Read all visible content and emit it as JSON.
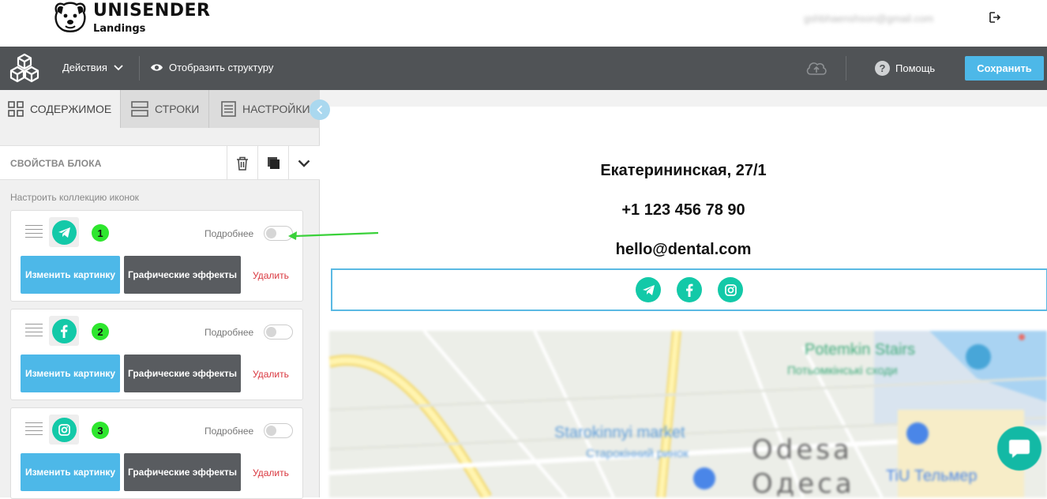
{
  "brand": {
    "title": "UNISENDER",
    "subtitle": "Landings"
  },
  "user": {
    "email": "gshbhaenshson@gmail.com"
  },
  "toolbar": {
    "actions_label": "Действия",
    "structure_label": "Отобразить структуру",
    "help_label": "Помощь",
    "save_label": "Сохранить"
  },
  "tabs": [
    {
      "label": "СОДЕРЖИМОЕ",
      "active": true
    },
    {
      "label": "СТРОКИ",
      "active": false
    },
    {
      "label": "НАСТРОЙКИ",
      "active": false
    }
  ],
  "block_props": {
    "title": "СВОЙСТВА БЛОКА",
    "collection_label": "Настроить коллекцию иконок"
  },
  "icon_items": [
    {
      "icon": "telegram-icon",
      "badge": "1",
      "more_label": "Подробнее",
      "toggle_on": false,
      "change_label": "Изменить картинку",
      "effects_label": "Графические эффекты",
      "delete_label": "Удалить"
    },
    {
      "icon": "facebook-icon",
      "badge": "2",
      "more_label": "Подробнее",
      "toggle_on": false,
      "change_label": "Изменить картинку",
      "effects_label": "Графические эффекты",
      "delete_label": "Удалить"
    },
    {
      "icon": "instagram-icon",
      "badge": "3",
      "more_label": "Подробнее",
      "toggle_on": false,
      "change_label": "Изменить картинку",
      "effects_label": "Графические эффекты",
      "delete_label": "Удалить"
    }
  ],
  "canvas": {
    "address": "Екатерининская, 27/1",
    "phone": "+1 123 456 78 90",
    "email": "hello@dental.com",
    "social_icons": [
      "telegram-icon",
      "facebook-icon",
      "instagram-icon"
    ],
    "map_labels": {
      "poi_1": "Potemkin Stairs",
      "poi_1_local": "Потьомкінські сходи",
      "poi_2": "Starokinnyi market",
      "poi_2_local": "Старокінний ринок",
      "city": "Odesa",
      "city_local": "Одеса",
      "poi_3": "TiU Тельмер"
    }
  },
  "colors": {
    "accent": "#4db8e8",
    "toolbar_bg": "#505356",
    "social_green": "#13c9a8",
    "badge_green": "#2ee62e",
    "delete_red": "#d9363e",
    "selection_border": "#5ab9e3"
  }
}
